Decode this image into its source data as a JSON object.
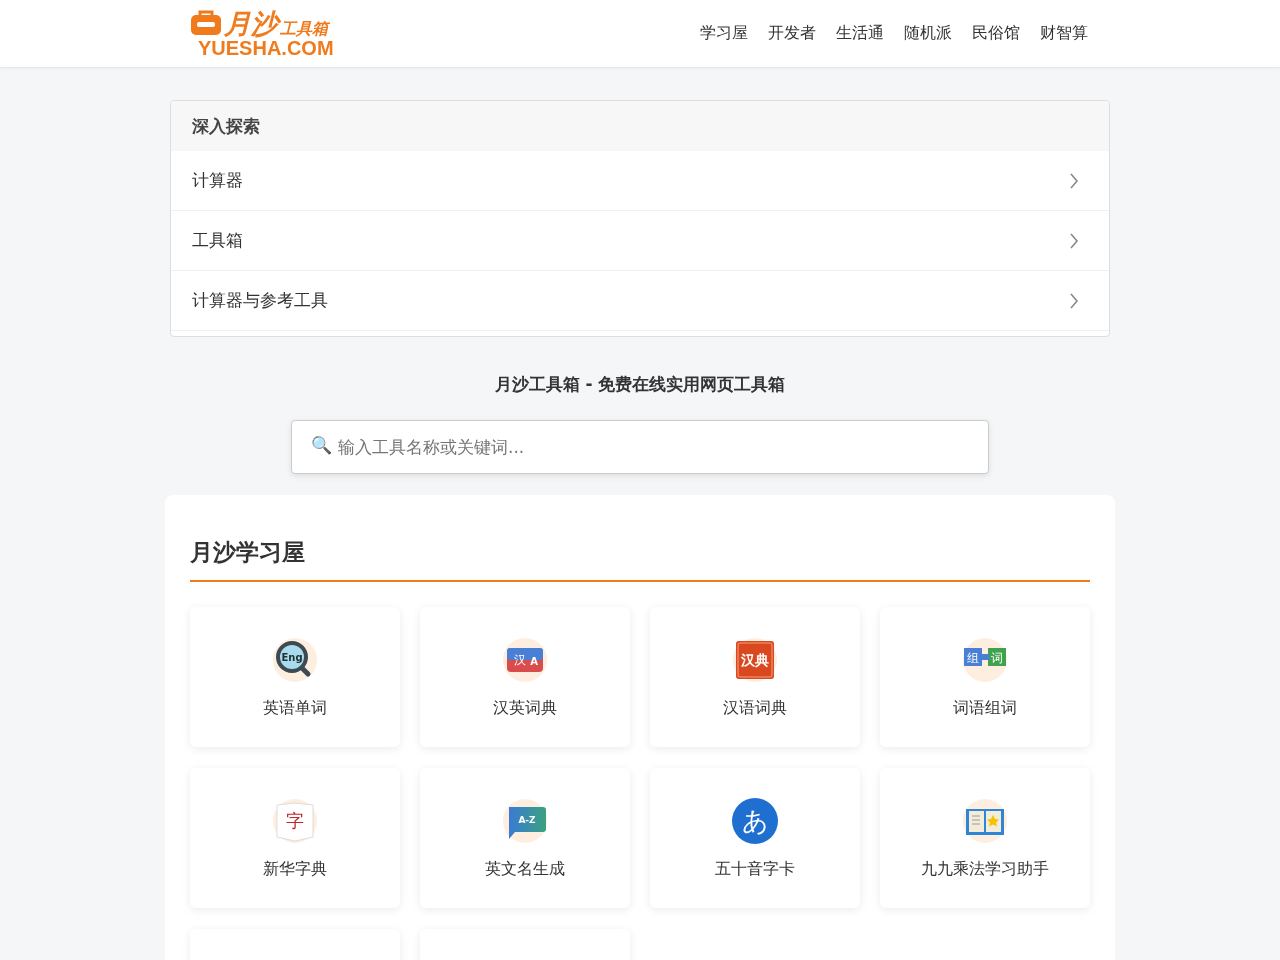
{
  "logo": {
    "main": "月沙",
    "sub": "工具箱",
    "domain": "YUESHA.COM"
  },
  "nav": [
    {
      "label": "学习屋"
    },
    {
      "label": "开发者"
    },
    {
      "label": "生活通"
    },
    {
      "label": "随机派"
    },
    {
      "label": "民俗馆"
    },
    {
      "label": "财智算"
    }
  ],
  "explore": {
    "title": "深入探索",
    "items": [
      {
        "label": "计算器"
      },
      {
        "label": "工具箱"
      },
      {
        "label": "计算器与参考工具"
      }
    ]
  },
  "site_title": "月沙工具箱 - 免费在线实用网页工具箱",
  "search": {
    "icon": "🔍",
    "placeholder": "输入工具名称或关键词..."
  },
  "section": {
    "title": "月沙学习屋",
    "tools": [
      {
        "kind": "magnifier",
        "icon_text": [
          "Eng"
        ],
        "label": "英语单词"
      },
      {
        "kind": "translate",
        "icon_text": [
          "汉",
          "A"
        ],
        "label": "汉英词典"
      },
      {
        "kind": "stamp",
        "icon_text": [
          "汉典"
        ],
        "label": "汉语词典"
      },
      {
        "kind": "blocks",
        "icon_text": [
          "组",
          "词"
        ],
        "label": "词语组词"
      },
      {
        "kind": "book",
        "icon_text": [
          "字"
        ],
        "label": "新华字典"
      },
      {
        "kind": "bubble",
        "icon_text": [
          "A-Z"
        ],
        "label": "英文名生成"
      },
      {
        "kind": "kana",
        "icon_text": [
          "あ"
        ],
        "label": "五十音字卡"
      },
      {
        "kind": "openbook",
        "label": "九九乘法学习助手"
      }
    ]
  }
}
